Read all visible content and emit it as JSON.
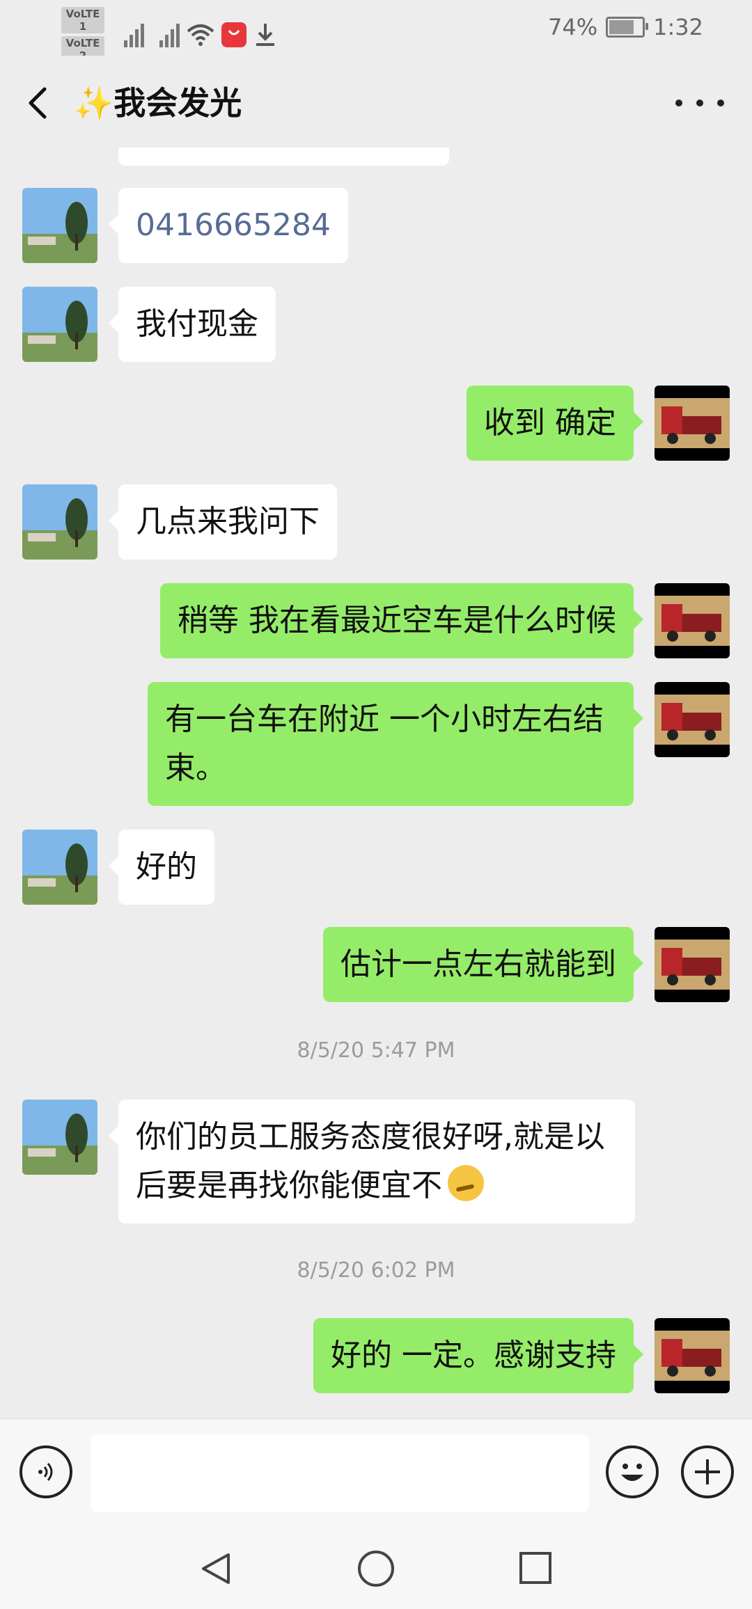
{
  "status_bar": {
    "sim1": "VoLTE 1",
    "sim2": "VoLTE 2",
    "battery_percent": "74%",
    "time": "1:32",
    "icons": [
      "signal-icon",
      "signal-icon",
      "wifi-icon",
      "app-store-icon",
      "download-icon",
      "battery-icon"
    ]
  },
  "nav": {
    "title": "✨我会发光",
    "back_icon": "back-icon",
    "more_icon": "more-icon"
  },
  "messages": [
    {
      "side": "in",
      "text": "0416665284",
      "is_phone": true
    },
    {
      "side": "in",
      "text": "我付现金"
    },
    {
      "side": "out",
      "text": "收到 确定"
    },
    {
      "side": "in",
      "text": "几点来我问下"
    },
    {
      "side": "out",
      "text": "稍等 我在看最近空车是什么时候"
    },
    {
      "side": "out",
      "text": "有一台车在附近 一个小时左右结束。"
    },
    {
      "side": "in",
      "text": "好的"
    },
    {
      "side": "out",
      "text": "估计一点左右就能到"
    },
    {
      "side": "time",
      "text": "8/5/20 5:47 PM"
    },
    {
      "side": "in",
      "text": "你们的员工服务态度很好呀,就是以后要是再找你能便宜不",
      "emoji": "thinking-face-emoji"
    },
    {
      "side": "time",
      "text": "8/5/20 6:02 PM"
    },
    {
      "side": "out",
      "text": "好的 一定。感谢支持"
    }
  ],
  "input_bar": {
    "voice_icon": "voice-icon",
    "input_value": "",
    "emoji_icon": "emoji-icon",
    "plus_icon": "plus-icon"
  },
  "colors": {
    "background": "#ededed",
    "outgoing_bubble": "#95ec69",
    "incoming_bubble": "#ffffff",
    "phone_link": "#576b95",
    "timestamp": "#9b9b9b"
  }
}
